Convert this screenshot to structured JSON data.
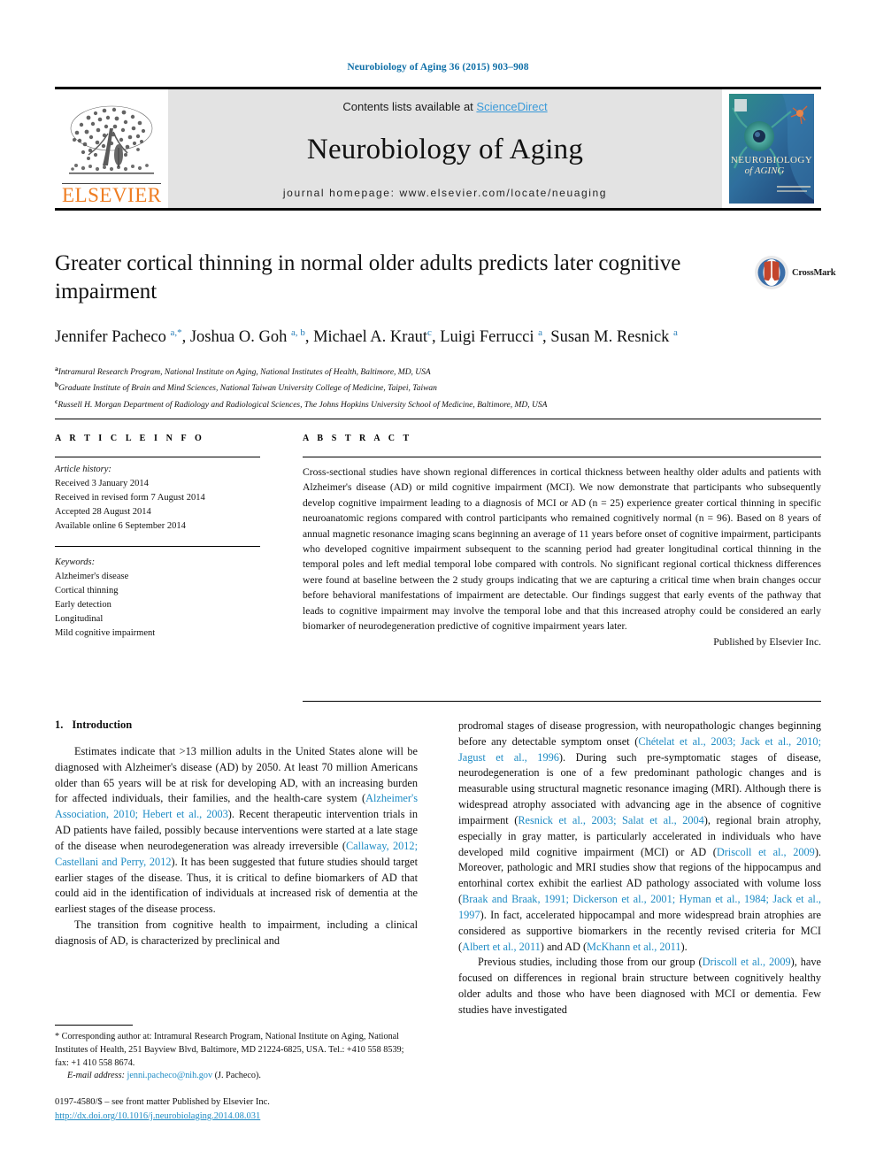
{
  "running_head": "Neurobiology of Aging 36 (2015) 903–908",
  "masthead": {
    "contents_prefix": "Contents lists available at ",
    "sciencedirect": "ScienceDirect",
    "journal_title": "Neurobiology of Aging",
    "homepage": "journal homepage: www.elsevier.com/locate/neuaging",
    "publisher_logo_text": "ELSEVIER",
    "cover_title_line1": "NEUROBIOLOGY",
    "cover_title_line2": "of AGING"
  },
  "crossmark": {
    "label": "CrossMark"
  },
  "title": "Greater cortical thinning in normal older adults predicts later cognitive impairment",
  "authors_html": "Jennifer Pacheco <sup>a,*</sup>, Joshua O. Goh <sup>a, b</sup>, Michael A. Kraut<sup>c</sup>, Luigi Ferrucci <sup>a</sup>, Susan M. Resnick <sup>a</sup>",
  "affiliations": [
    {
      "marker": "a",
      "text": "Intramural Research Program, National Institute on Aging, National Institutes of Health, Baltimore, MD, USA"
    },
    {
      "marker": "b",
      "text": "Graduate Institute of Brain and Mind Sciences, National Taiwan University College of Medicine, Taipei, Taiwan"
    },
    {
      "marker": "c",
      "text": "Russell H. Morgan Department of Radiology and Radiological Sciences, The Johns Hopkins University School of Medicine, Baltimore, MD, USA"
    }
  ],
  "headings": {
    "article_info": "A R T I C L E   I N F O",
    "abstract": "A B S T R A C T"
  },
  "article_history": {
    "label": "Article history:",
    "lines": [
      "Received 3 January 2014",
      "Received in revised form 7 August 2014",
      "Accepted 28 August 2014",
      "Available online 6 September 2014"
    ]
  },
  "keywords": {
    "label": "Keywords:",
    "items": [
      "Alzheimer's disease",
      "Cortical thinning",
      "Early detection",
      "Longitudinal",
      "Mild cognitive impairment"
    ]
  },
  "abstract_text": "Cross-sectional studies have shown regional differences in cortical thickness between healthy older adults and patients with Alzheimer's disease (AD) or mild cognitive impairment (MCI). We now demonstrate that participants who subsequently develop cognitive impairment leading to a diagnosis of MCI or AD (n = 25) experience greater cortical thinning in specific neuroanatomic regions compared with control participants who remained cognitively normal (n = 96). Based on 8 years of annual magnetic resonance imaging scans beginning an average of 11 years before onset of cognitive impairment, participants who developed cognitive impairment subsequent to the scanning period had greater longitudinal cortical thinning in the temporal poles and left medial temporal lobe compared with controls. No significant regional cortical thickness differences were found at baseline between the 2 study groups indicating that we are capturing a critical time when brain changes occur before behavioral manifestations of impairment are detectable. Our findings suggest that early events of the pathway that leads to cognitive impairment may involve the temporal lobe and that this increased atrophy could be considered an early biomarker of neurodegeneration predictive of cognitive impairment years later.",
  "abstract_publisher": "Published by Elsevier Inc.",
  "section_1": {
    "number": "1.",
    "title": "Introduction"
  },
  "intro_para_1_html": "Estimates indicate that &gt;13 million adults in the United States alone will be diagnosed with Alzheimer's disease (AD) by 2050. At least 70 million Americans older than 65 years will be at risk for developing AD, with an increasing burden for affected individuals, their families, and the health-care system (<span class=\"cit\">Alzheimer's Association, 2010; Hebert et al., 2003</span>). Recent therapeutic intervention trials in AD patients have failed, possibly because interventions were started at a late stage of the disease when neurodegeneration was already irreversible (<span class=\"cit\">Callaway, 2012; Castellani and Perry, 2012</span>). It has been suggested that future studies should target earlier stages of the disease. Thus, it is critical to define biomarkers of AD that could aid in the identification of individuals at increased risk of dementia at the earliest stages of the disease process.",
  "intro_para_2_html": "The transition from cognitive health to impairment, including a clinical diagnosis of AD, is characterized by preclinical and",
  "intro_para_2_cont_html": "prodromal stages of disease progression, with neuropathologic changes beginning before any detectable symptom onset (<span class=\"cit\">Chételat et al., 2003; Jack et al., 2010; Jagust et al., 1996</span>). During such pre-symptomatic stages of disease, neurodegeneration is one of a few predominant pathologic changes and is measurable using structural magnetic resonance imaging (MRI). Although there is widespread atrophy associated with advancing age in the absence of cognitive impairment (<span class=\"cit\">Resnick et al., 2003; Salat et al., 2004</span>), regional brain atrophy, especially in gray matter, is particularly accelerated in individuals who have developed mild cognitive impairment (MCI) or AD (<span class=\"cit\">Driscoll et al., 2009</span>). Moreover, pathologic and MRI studies show that regions of the hippocampus and entorhinal cortex exhibit the earliest AD pathology associated with volume loss (<span class=\"cit\">Braak and Braak, 1991; Dickerson et al., 2001; Hyman et al., 1984; Jack et al., 1997</span>). In fact, accelerated hippocampal and more widespread brain atrophies are considered as supportive biomarkers in the recently revised criteria for MCI (<span class=\"cit\">Albert et al., 2011</span>) and AD (<span class=\"cit\">McKhann et al., 2011</span>).",
  "intro_para_3_html": "Previous studies, including those from our group (<span class=\"cit\">Driscoll et al., 2009</span>), have focused on differences in regional brain structure between cognitively healthy older adults and those who have been diagnosed with MCI or dementia. Few studies have investigated",
  "footnote_html": "* Corresponding author at: Intramural Research Program, National Institute on Aging, National Institutes of Health, 251 Bayview Blvd, Baltimore, MD 21224-6825, USA. Tel.: +410 558 8539; fax: +1 410 558 8674.",
  "email_label": "E-mail address:",
  "email_address": "jenni.pacheco@nih.gov",
  "email_suffix": "(J. Pacheco).",
  "copyright_line": "0197-4580/$ – see front matter Published by Elsevier Inc.",
  "doi": "http://dx.doi.org/10.1016/j.neurobiolaging.2014.08.031",
  "colors": {
    "link_blue": "#1d8bc4",
    "running_head_blue": "#1070a8",
    "sciencedirect_blue": "#3a9ad9",
    "elsevier_orange": "#ef7d22",
    "masthead_grey": "#e3e3e3"
  }
}
